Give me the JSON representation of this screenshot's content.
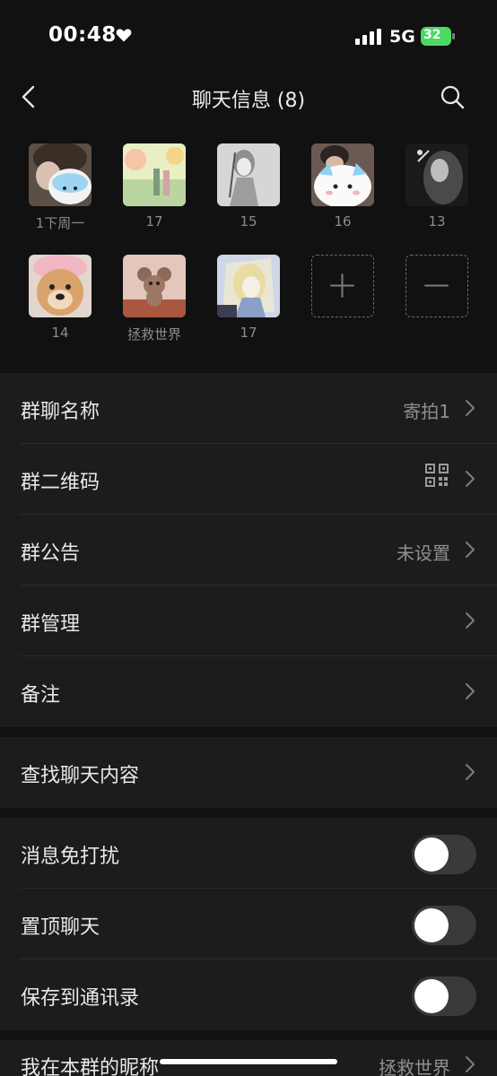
{
  "status_bar": {
    "time": "00:48",
    "network": "5G",
    "battery": "32",
    "battery_color": "#4cd964"
  },
  "nav": {
    "title": "聊天信息 (8)",
    "back_icon": "chevron-left-icon",
    "search_icon": "search-icon"
  },
  "members": [
    {
      "name": "1下周一"
    },
    {
      "name": "17"
    },
    {
      "name": "15"
    },
    {
      "name": "16"
    },
    {
      "name": "13"
    },
    {
      "name": "14"
    },
    {
      "name": "拯救世界"
    },
    {
      "name": "17"
    }
  ],
  "member_actions": {
    "add_icon": "plus-icon",
    "remove_icon": "minus-icon"
  },
  "group_settings": [
    {
      "label": "群聊名称",
      "value": "寄拍1"
    },
    {
      "label": "群二维码",
      "icon": "qr-code-icon"
    },
    {
      "label": "群公告",
      "value": "未设置"
    },
    {
      "label": "群管理"
    },
    {
      "label": "备注"
    }
  ],
  "search_section": {
    "label": "查找聊天内容"
  },
  "toggles": [
    {
      "label": "消息免打扰",
      "on": false
    },
    {
      "label": "置顶聊天",
      "on": false
    },
    {
      "label": "保存到通讯录",
      "on": false
    }
  ],
  "nickname_row": {
    "label": "我在本群的昵称",
    "value": "拯救世界"
  },
  "colors": {
    "background": "#111111",
    "section": "#1c1c1c",
    "secondary_text": "#8f8f8f"
  }
}
